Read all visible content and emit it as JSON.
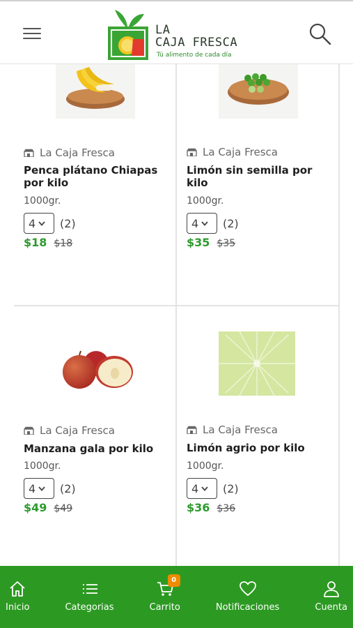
{
  "header": {
    "logo_line1": "LA",
    "logo_line2": "CAJA FRESCA",
    "tagline": "Tú alimento de cada día"
  },
  "products": [
    {
      "vendor": "La Caja Fresca",
      "name": "Penca plátano Chiapas por kilo",
      "unit": "1000gr.",
      "qty_selected": "4",
      "qty_count": "(2)",
      "price": "$18",
      "old_price": "$18",
      "image_icon": "banana-tray-image"
    },
    {
      "vendor": "La Caja Fresca",
      "name": "Limón sin semilla por kilo",
      "unit": "1000gr.",
      "qty_selected": "4",
      "qty_count": "(2)",
      "price": "$35",
      "old_price": "$35",
      "image_icon": "lime-tray-image"
    },
    {
      "vendor": "La Caja Fresca",
      "name": "Manzana gala por kilo",
      "unit": "1000gr.",
      "qty_selected": "4",
      "qty_count": "(2)",
      "price": "$49",
      "old_price": "$49",
      "image_icon": "apple-image"
    },
    {
      "vendor": "La Caja Fresca",
      "name": "Limón agrio por kilo",
      "unit": "1000gr.",
      "qty_selected": "4",
      "qty_count": "(2)",
      "price": "$36",
      "old_price": "$36",
      "image_icon": "lime-slice-image"
    }
  ],
  "nav": {
    "items": [
      {
        "label": "Inicio",
        "icon": "home-icon"
      },
      {
        "label": "Categorias",
        "icon": "list-icon"
      },
      {
        "label": "Carrito",
        "icon": "cart-icon",
        "badge": "0"
      },
      {
        "label": "Notificaciones",
        "icon": "heart-icon"
      },
      {
        "label": "Cuenta",
        "icon": "user-icon"
      }
    ]
  },
  "colors": {
    "brand_green": "#2c9a22",
    "price_green": "#2e9a2e",
    "badge_orange": "#f08a00"
  }
}
